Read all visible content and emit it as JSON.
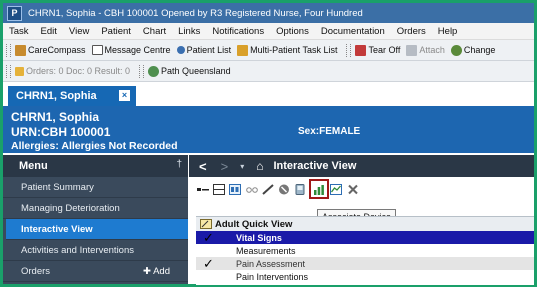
{
  "window": {
    "app_icon_letter": "P",
    "title": "CHRN1, Sophia - CBH 100001   Opened by R3 Registered Nurse, Four Hundred"
  },
  "menubar": {
    "items": [
      "Task",
      "Edit",
      "View",
      "Patient",
      "Chart",
      "Links",
      "Notifications",
      "Options",
      "Documentation",
      "Orders",
      "Help"
    ]
  },
  "toolbar1": {
    "items": [
      {
        "label": "CareCompass",
        "icon": "care-compass-icon"
      },
      {
        "label": "Message Centre",
        "icon": "message-centre-icon"
      },
      {
        "label": "Patient List",
        "icon": "patient-list-icon"
      },
      {
        "label": "Multi-Patient Task List",
        "icon": "multi-patient-task-list-icon"
      },
      {
        "label": "Tear Off",
        "icon": "tear-off-icon"
      },
      {
        "label": "Attach",
        "icon": "attach-icon"
      },
      {
        "label": "Change",
        "icon": "change-icon"
      }
    ]
  },
  "toolbar2": {
    "counters": "Orders: 0  Doc: 0  Result: 0",
    "link": "Path Queensland"
  },
  "patient_tab": {
    "name": "CHRN1, Sophia",
    "close_glyph": "×"
  },
  "banner": {
    "name": "CHRN1, Sophia",
    "urn": "URN:CBH 100001",
    "allergies": "Allergies: Allergies Not Recorded",
    "sex": "Sex:FEMALE"
  },
  "left_menu": {
    "title": "Menu",
    "pin_glyph": "†",
    "items": [
      {
        "label": "Patient Summary"
      },
      {
        "label": "Managing Deterioration"
      },
      {
        "label": "Interactive View"
      },
      {
        "label": "Activities and Interventions"
      },
      {
        "label": "Orders"
      }
    ],
    "add_label": "Add"
  },
  "content": {
    "back_glyph": "<",
    "forward_glyph": ">",
    "dropdown_glyph": "▾",
    "home_glyph": "⌂",
    "title": "Interactive View",
    "tooltip": "Associate Device"
  },
  "navigator": {
    "band_title": "Adult Quick View",
    "sections": [
      {
        "label": "Vital Signs",
        "checked": true,
        "selected": true
      },
      {
        "label": "Measurements",
        "checked": false
      },
      {
        "label": "Pain Assessment",
        "checked": true
      },
      {
        "label": "Pain Interventions",
        "checked": false
      }
    ],
    "check_glyph": "✓"
  },
  "colors": {
    "frame_border": "#1aa06a",
    "banner_blue": "#1d66b0",
    "menu_dark": "#3a4a5c",
    "active_item": "#1e7bd0",
    "highlight_box": "#a01818",
    "selected_row": "#1a1aa8"
  }
}
